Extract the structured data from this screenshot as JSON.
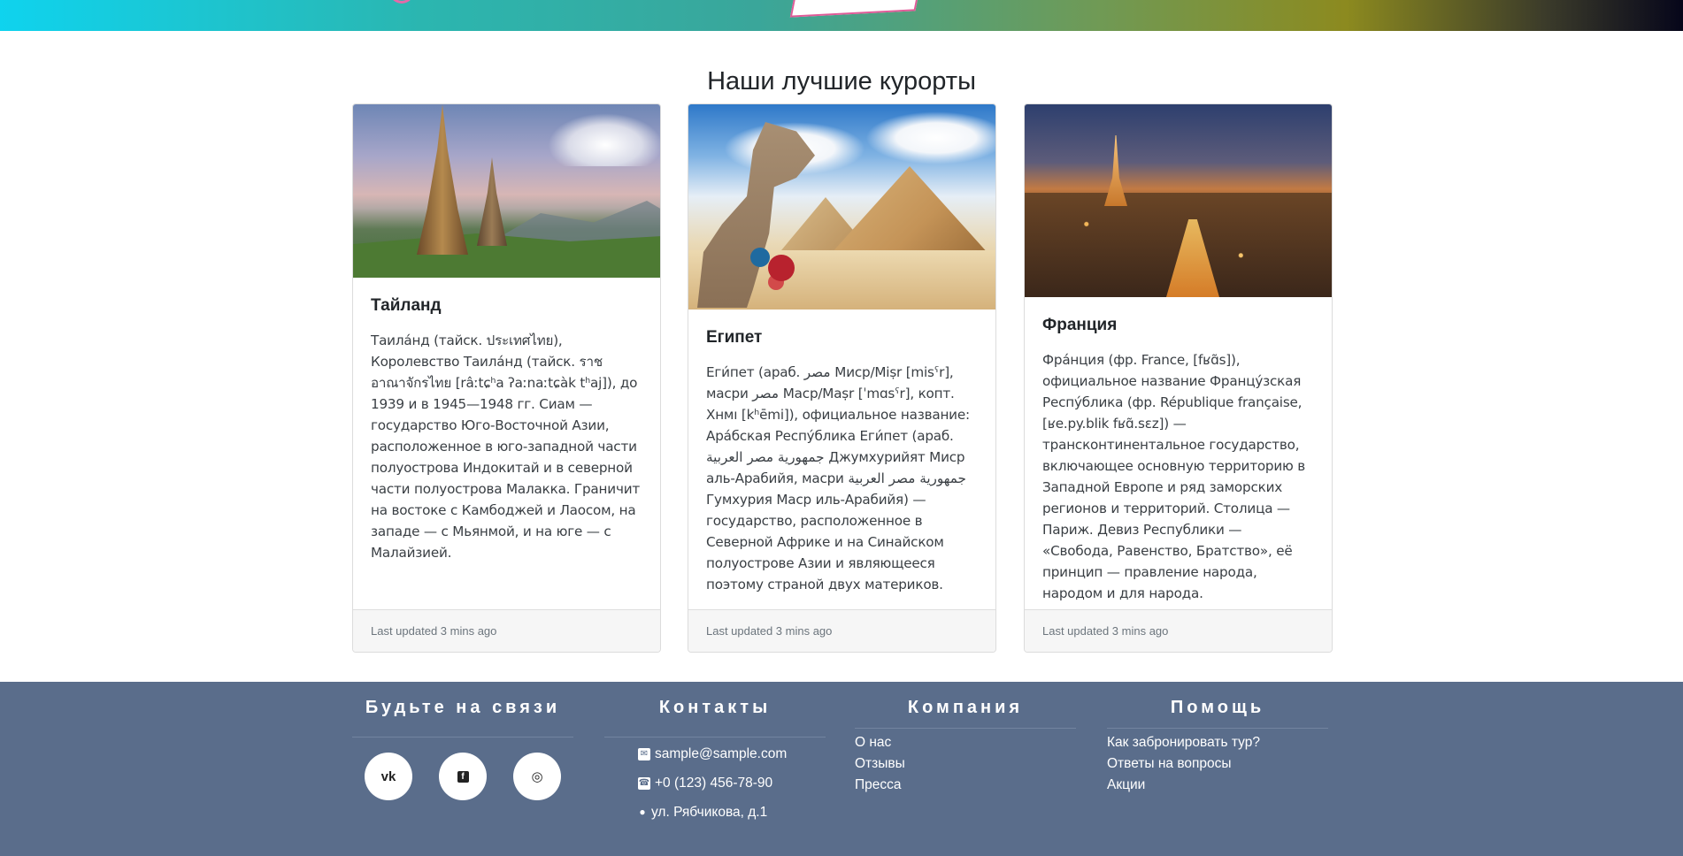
{
  "page": {
    "section_title": "Наши лучшие курорты"
  },
  "cards": [
    {
      "title": "Тайланд",
      "text": "Таила́нд (тайск. ประเทศไทย), Королевство Таила́нд (тайск. ราชอาณาจักรไทย [râːtɕʰa ʔaːnaːtɕàk tʰaj]), до 1939 и в 1945—1948 гг. Сиам — государство Юго-Восточной Азии, расположенное в юго-западной части полуострова Индокитай и в северной части полуострова Малакка. Граничит на востоке с Камбоджей и Лаосом, на западе — с Мьянмой, и на юге — с Малайзией.",
      "footer": "Last updated 3 mins ago"
    },
    {
      "title": "Египет",
      "text": "Еги́пет (араб. مصر‎ Миср/Miṣr [misˤr], масри مصر‎ Маср/Maṣr [ˈmɑsˤr], копт. Хнмı [kʰēmi]), официальное название: Ара́бская Респу́блика Еги́пет (араб. جمهورية مصر العربية‎ Джумхурийят Миср аль-Арабийя, масри جمهورية مصر العربية‎ Гумхурия Маср иль-Арабийя) — государство, расположенное в Северной Африке и на Синайском полуострове Азии и являющееся поэтому страной двух материков.",
      "footer": "Last updated 3 mins ago"
    },
    {
      "title": "Франция",
      "text": "Фра́нция (фр. France, [fʁɑ̃s]), официальное название Францу́зская Респу́блика (фр. République française, [ʁe.py.blik fʁɑ̃.sɛz]) — трансконтинентальное государство, включающее основную территорию в Западной Европе и ряд заморских регионов и территорий. Столица — Париж. Девиз Республики — «Свобода, Равенство, Братство», её принцип — правление народа, народом и для народа.",
      "footer": "Last updated 3 mins ago"
    }
  ],
  "footer": {
    "social": {
      "heading": "Будьте на связи",
      "items": [
        {
          "icon": "vk-icon",
          "glyph": "vk"
        },
        {
          "icon": "facebook-icon",
          "glyph": "f"
        },
        {
          "icon": "instagram-icon",
          "glyph": "◎"
        }
      ]
    },
    "contacts": {
      "heading": "Контакты",
      "email": "sample@sample.com",
      "phone": "+0 (123) 456-78-90",
      "address": "ул. Рябчикова, д.1"
    },
    "company": {
      "heading": "Компания",
      "links": [
        "О нас",
        "Отзывы",
        "Пресса"
      ]
    },
    "help": {
      "heading": "Помощь",
      "links": [
        "Как забронировать тур?",
        "Ответы на вопросы",
        "Акции"
      ]
    }
  }
}
